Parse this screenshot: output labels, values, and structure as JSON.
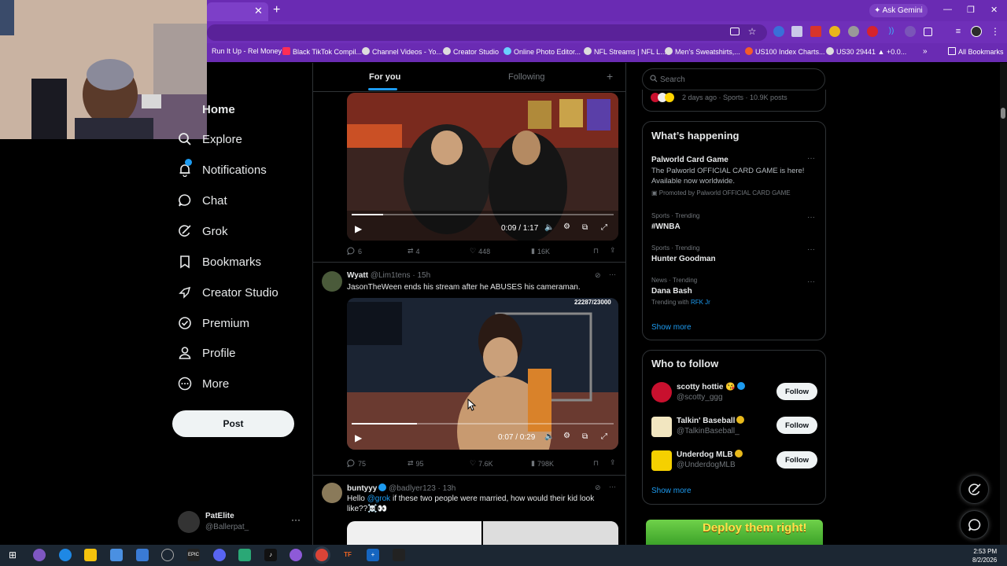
{
  "browser": {
    "ask_gemini": "Ask Gemini",
    "bookmarks": [
      "Run It Up - Rel Money",
      "Black TikTok Compil...",
      "Channel Videos - Yo...",
      "Creator Studio",
      "Online Photo Editor...",
      "NFL Streams | NFL L...",
      "Men's Sweatshirts,...",
      "US100 Index Charts...",
      "US30 29441 ▲ +0.0..."
    ],
    "all_bookmarks": "All Bookmarks"
  },
  "nav": {
    "home": "Home",
    "explore": "Explore",
    "notifications": "Notifications",
    "chat": "Chat",
    "grok": "Grok",
    "bookmarks": "Bookmarks",
    "creator_studio": "Creator Studio",
    "premium": "Premium",
    "profile": "Profile",
    "more": "More",
    "post": "Post"
  },
  "account": {
    "name": "PatElite",
    "handle": "@Ballerpat_"
  },
  "feed": {
    "tabs": {
      "for_you": "For you",
      "following": "Following"
    },
    "post1": {
      "time": "0:09 / 1:17",
      "replies": "6",
      "reposts": "4",
      "likes": "448",
      "views": "16K"
    },
    "post2": {
      "author": "Wyatt",
      "handle": "@Lim1tens · 15h",
      "text": "JasonTheWeen ends his stream after he ABUSES his cameraman.",
      "overlay": "22287/23000",
      "time": "0:07 / 0:29",
      "replies": "75",
      "reposts": "95",
      "likes": "7.6K",
      "views": "798K"
    },
    "post3": {
      "author": "buntyyy",
      "handle": "@badlyer123 · 13h",
      "text_prefix": "Hello ",
      "mention": "@grok",
      "text_suffix": " if these two people were married, how would their kid look",
      "text_line2": "like??☠️👀"
    }
  },
  "right": {
    "search_placeholder": "Search",
    "top_meta": "2 days ago · Sports · 10.9K posts",
    "happening": {
      "title": "What’s happening",
      "promo_title": "Palworld Card Game",
      "promo_desc1": "The Palworld OFFICIAL CARD GAME is here!",
      "promo_desc2": "Available now worldwide.",
      "promo_by": "Promoted by Palworld OFFICIAL CARD GAME",
      "t1_meta": "Sports · Trending",
      "t1_title": "#WNBA",
      "t2_meta": "Sports · Trending",
      "t2_title": "Hunter Goodman",
      "t3_meta": "News · Trending",
      "t3_title": "Dana Bash",
      "t3_with": "Trending with ",
      "t3_link": "RFK Jr",
      "show_more": "Show more"
    },
    "who_to_follow": {
      "title": "Who to follow",
      "users": [
        {
          "name": "scotty hottie 😘",
          "handle": "@scotty_ggg"
        },
        {
          "name": "Talkin' Baseball",
          "handle": "@TalkinBaseball_"
        },
        {
          "name": "Underdog MLB",
          "handle": "@UnderdogMLB"
        }
      ],
      "follow": "Follow",
      "show_more": "Show more"
    },
    "ad_text": "Deploy them right!"
  },
  "taskbar": {
    "time": "2:53 PM",
    "date": "8/2/2026"
  }
}
